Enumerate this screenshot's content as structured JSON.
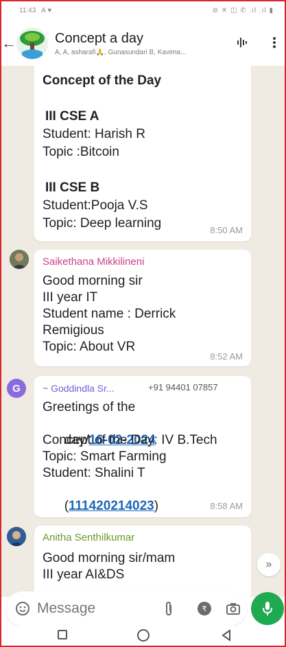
{
  "status_bar": {
    "time": "11:43",
    "left_icons": "A ♥",
    "right_icons": "⊘ ✕ ◫ ✆ .ıl .ıl ▮"
  },
  "header": {
    "title": "Concept a day",
    "subtitle": "A, A, asharafi🙏, Gunasundari B, Kavima..."
  },
  "messages": [
    {
      "lines": [
        "Concept of the Day",
        "",
        "III CSE A",
        "Student: Harish R",
        "Topic :Bitcoin",
        "",
        "III CSE B",
        "Student:Pooja V.S",
        "Topic: Deep learning"
      ],
      "time": "8:50 AM"
    },
    {
      "sender": "Saikethana Mikkilineni",
      "sender_color": "#c9418a",
      "lines": [
        "Good morning sir",
        "III year IT",
        "Student name : Derrick",
        "Remigious",
        "Topic: About VR"
      ],
      "time": "8:52 AM"
    },
    {
      "sender": "~ Goddindla Sr...",
      "sender_phone": "+91 94401 07857",
      "sender_color": "#7a5bd6",
      "avatar_letter": "G",
      "line1": "Greetings of the",
      "line2_prefix": "day/",
      "line2_link": "16-02-2024",
      "line3": "Concept of the Day: IV B.Tech",
      "line4": "Topic: Smart Farming",
      "line5": "Student: Shalini T",
      "line6_open": "(",
      "line6_link": "111420214023",
      "line6_close": ")",
      "time": "8:58 AM"
    },
    {
      "sender": "Anitha Senthilkumar",
      "sender_color": "#6a9a2a",
      "lines": [
        "Good morning sir/mam",
        "III year AI&DS"
      ]
    }
  ],
  "input": {
    "placeholder": "Message"
  },
  "colors": {
    "chat_background": "#efeae2",
    "accent_green": "#1faa52",
    "link_blue": "#1b66b8"
  }
}
